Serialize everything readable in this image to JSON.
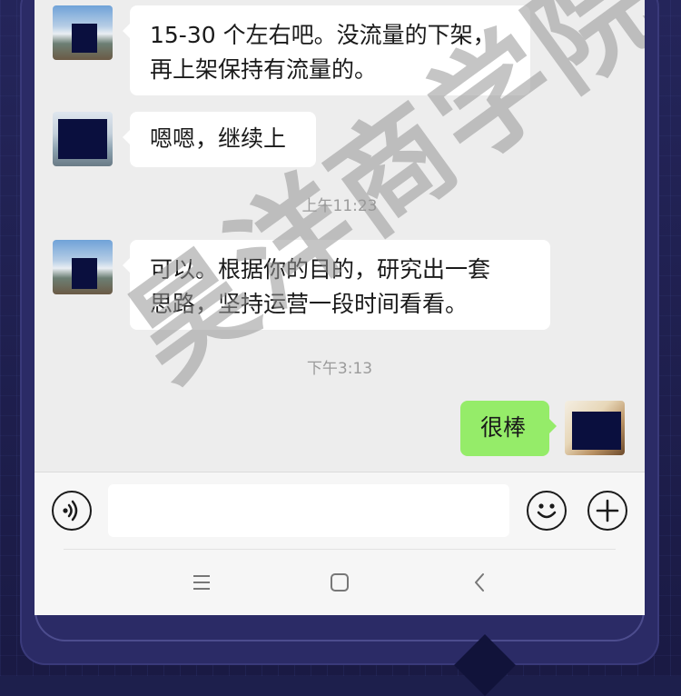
{
  "messages": [
    {
      "id": "m1",
      "side": "left",
      "lines": [
        "15-30 个左右吧。没流量的下架，",
        "再上架保持有流量的。"
      ]
    },
    {
      "id": "m2",
      "side": "left",
      "lines": [
        "嗯嗯，继续上"
      ]
    },
    {
      "id": "t1",
      "type": "time",
      "text": "上午11:23"
    },
    {
      "id": "m3",
      "side": "left",
      "lines": [
        "可以。根据你的目的，研究出一套",
        "思路，坚持运营一段时间看看。"
      ]
    },
    {
      "id": "t2",
      "type": "time",
      "text": "下午3:13"
    },
    {
      "id": "m4",
      "side": "right",
      "lines": [
        "很棒"
      ]
    }
  ],
  "input": {
    "placeholder": "",
    "value": ""
  },
  "icons": {
    "voice": "voice-icon",
    "emoji": "emoji-icon",
    "add": "plus-icon",
    "nav_menu": "menu-icon",
    "nav_home": "home-icon",
    "nav_back": "back-icon"
  },
  "watermark": "昊洋商学院",
  "colors": {
    "bubble_right": "#95ec69",
    "bubble_left": "#ffffff",
    "chat_bg": "#ededed"
  }
}
